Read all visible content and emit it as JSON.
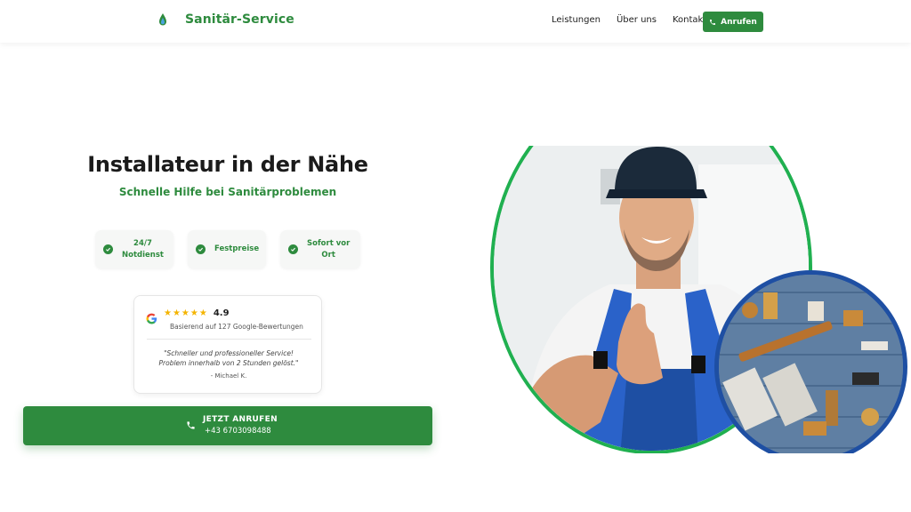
{
  "brand": {
    "name": "Sanitär-Service"
  },
  "nav": {
    "items": [
      "Leistungen",
      "Über uns",
      "Kontakt"
    ],
    "call_label": "Anrufen"
  },
  "hero": {
    "title": "Installateur in der Nähe",
    "subtitle": "Schnelle Hilfe bei Sanitärproblemen"
  },
  "badges": [
    {
      "line1": "24/7",
      "line2": "Notdienst"
    },
    {
      "line1": "Festpreise",
      "line2": ""
    },
    {
      "line1": "Sofort vor",
      "line2": "Ort"
    }
  ],
  "review": {
    "stars": "★★★★★",
    "rating": "4.9",
    "based_on": "Basierend auf 127 Google-Bewertungen",
    "quote_line1": "\"Schneller und professioneller Service!",
    "quote_line2": "Problem innerhalb von 2 Stunden gelöst.\"",
    "author": "- Michael K."
  },
  "cta": {
    "label": "JETZT ANRUFEN",
    "phone": "+43 6703098488"
  },
  "colors": {
    "accent": "#2e8b3e",
    "ring_green": "#20b050",
    "ring_blue": "#1e4fa3",
    "star": "#f4b400"
  }
}
